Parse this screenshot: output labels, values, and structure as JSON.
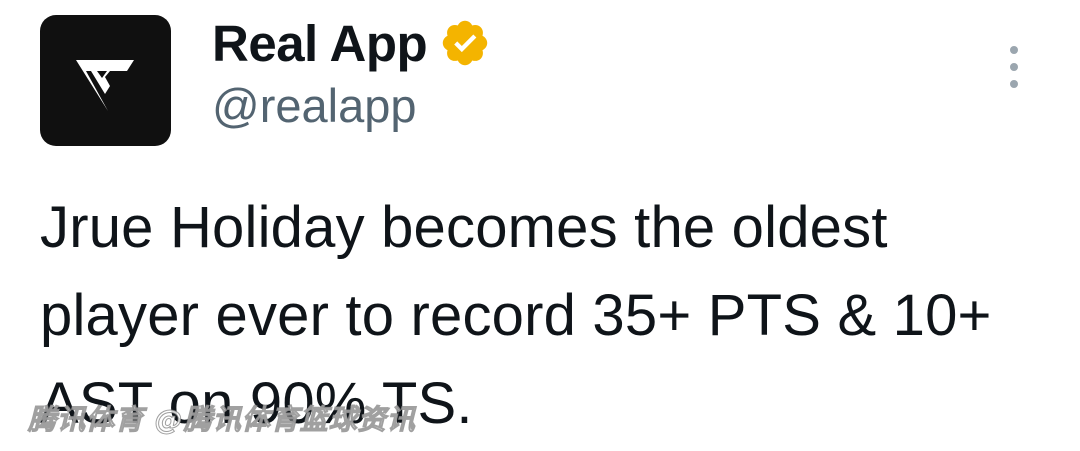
{
  "author": {
    "display_name": "Real App",
    "handle": "@realapp",
    "avatar_icon": "real-app-logo-icon",
    "verified_icon": "verified-badge-icon",
    "verified_color": "#f4b400"
  },
  "menu": {
    "more_icon": "more-vertical-icon"
  },
  "tweet": {
    "text": "Jrue Holiday becomes the oldest player ever to record 35+ PTS & 10+ AST on 90% TS."
  },
  "watermark": {
    "text": "腾讯体育 @腾讯体育篮球资讯"
  }
}
